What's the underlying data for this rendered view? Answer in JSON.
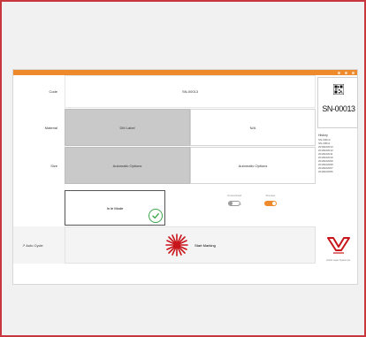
{
  "window": {
    "title": ""
  },
  "labels": {
    "code": "Code",
    "material": "Material",
    "size": "Size",
    "auto_cycle": "↗ Auto Cycle"
  },
  "code_value": "SN-00013",
  "material": {
    "options": [
      "DM Label",
      "N/A"
    ],
    "selected": 0
  },
  "size": {
    "options": [
      "Automatic Options",
      "Automatic Options"
    ],
    "selected": 0
  },
  "start_button": {
    "label": "In le Mode",
    "status_icon": "check-circle-icon",
    "status_color": "#3aa64a"
  },
  "toggles": [
    {
      "label": "Unrestricted",
      "off_label": "Off",
      "state": "off"
    },
    {
      "label": "Preview",
      "state": "on"
    }
  ],
  "marking_button": {
    "label": "Start Marking",
    "icon": "laser-icon",
    "icon_color": "#c8151b"
  },
  "serial": {
    "big_text": "SN-00013",
    "qr_icon": "qr-code-icon"
  },
  "history": {
    "title": "History",
    "items": [
      "SN-00013",
      "SN-00011",
      "2019022013",
      "2019022012",
      "2019022011",
      "2019022010",
      "2019022009",
      "2019022008",
      "2019022007",
      "2019022006"
    ]
  },
  "logo": {
    "caption": "LOGO Laser System Inc.",
    "color": "#c8151b"
  },
  "colors": {
    "accent": "#ef8a2c",
    "frame": "#c8373d",
    "selected": "#c9c9c9"
  }
}
